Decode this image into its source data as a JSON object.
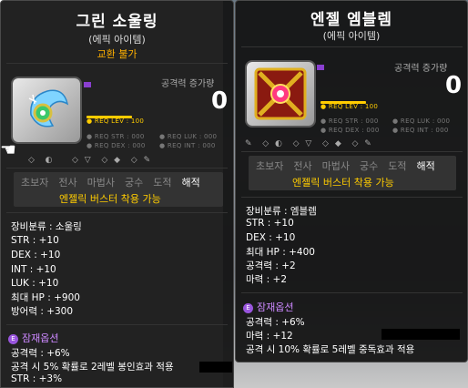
{
  "left_tooltip": {
    "title": "그린 소울링",
    "subtitle": "(에픽 아이템)",
    "trade": "교환 불가",
    "attack_label": "공격력 증가량",
    "attack_value": "0",
    "req_level": "● REQ LEV : 100",
    "req_row1_a": "● REQ STR : 000",
    "req_row1_b": "● REQ LUK : 000",
    "req_row2_a": "● REQ DEX : 000",
    "req_row2_b": "● REQ INT : 000",
    "jobs": [
      "초보자",
      "전사",
      "마법사",
      "궁수",
      "도적",
      "해적"
    ],
    "buster": "엔젤릭 버스터 착용 가능",
    "stats": [
      "장비분류 : 소울링",
      "STR : +10",
      "DEX : +10",
      "INT : +10",
      "LUK : +10",
      "최대 HP : +900",
      "방어력 : +300"
    ],
    "potential_title": "잠재옵션",
    "potential_lines": [
      "공격력 : +6%",
      "공격 시 5% 확률로 2레벨 봉인효과 적용",
      "STR : +3%"
    ]
  },
  "right_tooltip": {
    "title": "엔젤 엠블렘",
    "subtitle": "(에픽 아이템)",
    "attack_label": "공격력 증가량",
    "attack_value": "0",
    "req_level": "● REQ LEV : 100",
    "req_row1_a": "● REQ STR : 000",
    "req_row1_b": "● REQ LUK : 000",
    "req_row2_a": "● REQ DEX : 000",
    "req_row2_b": "● REQ INT : 000",
    "jobs": [
      "초보자",
      "전사",
      "마법사",
      "궁수",
      "도적",
      "해적"
    ],
    "buster": "엔젤릭 버스터 착용 가능",
    "stats": [
      "장비분류 : 엠블렘",
      "STR : +10",
      "DEX : +10",
      "최대 HP : +400",
      "공격력 : +2",
      "마력 : +2"
    ],
    "potential_title": "잠재옵션",
    "potential_lines": [
      "공격력 : +6%",
      "마력 : +12",
      "공격 시 10% 확률로 5레벨 중독효과 적용"
    ]
  },
  "potential_badge": "E",
  "colors": {
    "gold": "#ffcc00",
    "trade_orange": "#ffb000",
    "potential_purple": "#cc88ff",
    "epic_flag": "#8a3fd0"
  }
}
